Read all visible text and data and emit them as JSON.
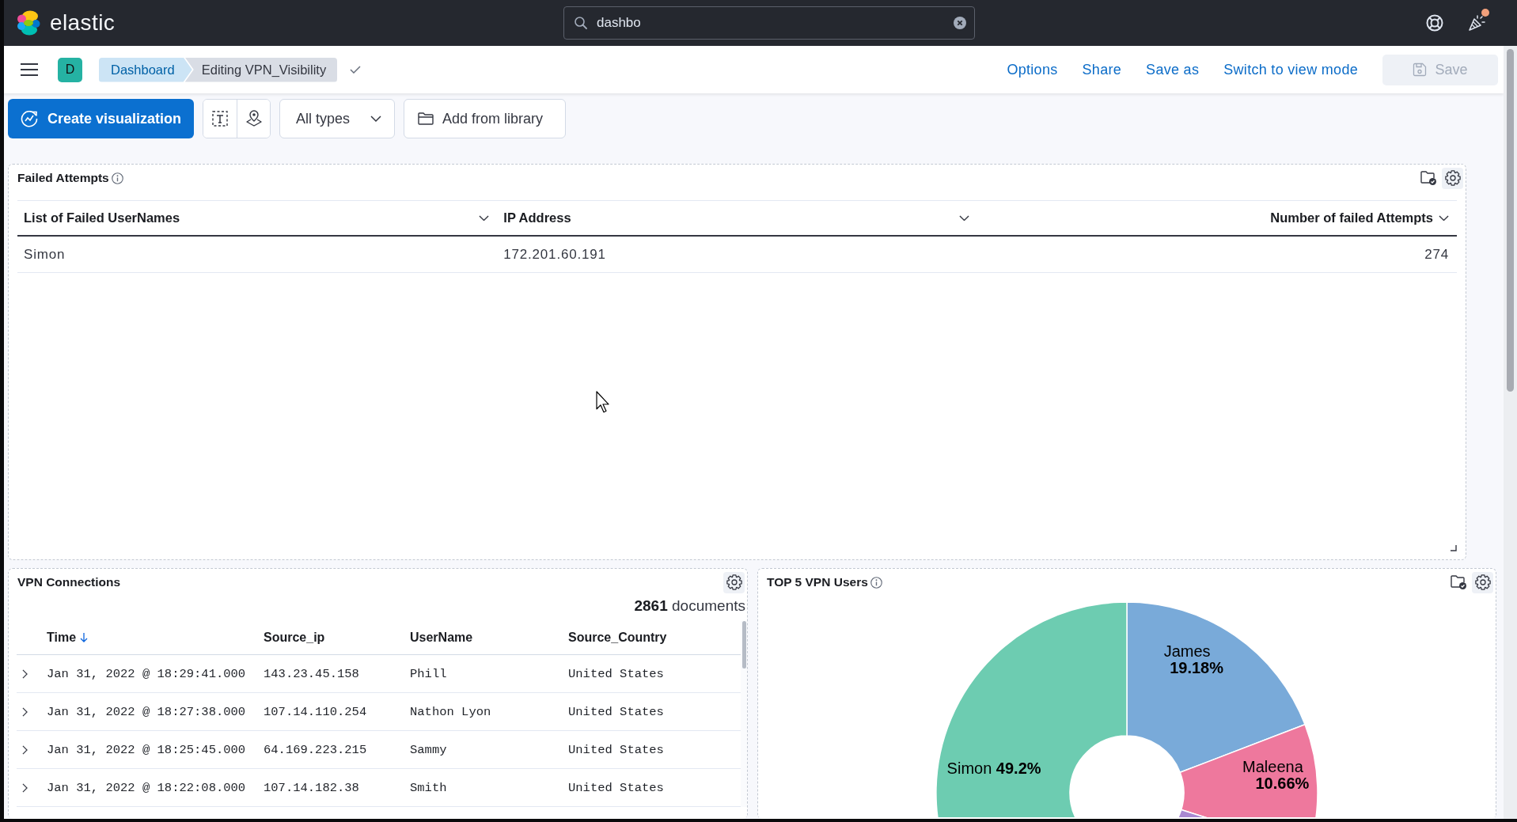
{
  "header": {
    "logo_text": "elastic",
    "search": {
      "value": "dashbo"
    },
    "news_unread": true
  },
  "app_bar": {
    "avatar": "D",
    "breadcrumbs": [
      {
        "label": "Dashboard",
        "current": false
      },
      {
        "label": "Editing VPN_Visibility",
        "current": true
      }
    ],
    "actions": [
      {
        "label": "Options"
      },
      {
        "label": "Share"
      },
      {
        "label": "Save as"
      },
      {
        "label": "Switch to view mode"
      }
    ],
    "save_button": {
      "label": "Save",
      "disabled": true
    }
  },
  "toolbar": {
    "create_button": "Create visualization",
    "type_filter": "All types",
    "library_button": "Add from library"
  },
  "panels": [
    {
      "kind": "data_table",
      "title": "Failed Attempts",
      "info": true,
      "in_library": true,
      "columns": [
        {
          "label": "List of Failed UserNames",
          "kind": "text"
        },
        {
          "label": "IP Address",
          "kind": "text"
        },
        {
          "label": "Number of failed Attempts",
          "kind": "number"
        }
      ],
      "rows": [
        [
          "Simon",
          "172.201.60.191",
          "274"
        ]
      ]
    },
    {
      "kind": "documents",
      "title": "VPN Connections",
      "info": false,
      "in_library": false,
      "hit_count": "**2861** documents",
      "columns": [
        {
          "label": "Time",
          "sorted": true
        },
        {
          "label": "Source_ip",
          "sorted": false
        },
        {
          "label": "UserName",
          "sorted": false
        },
        {
          "label": "Source_Country",
          "sorted": false
        }
      ],
      "rows": [
        [
          "Jan 31, 2022 @ 18:29:41.000",
          "143.23.45.158",
          "Phill",
          "United States"
        ],
        [
          "Jan 31, 2022 @ 18:27:38.000",
          "107.14.110.254",
          "Nathon Lyon",
          "United States"
        ],
        [
          "Jan 31, 2022 @ 18:25:45.000",
          "64.169.223.215",
          "Sammy",
          "United States"
        ],
        [
          "Jan 31, 2022 @ 18:22:08.000",
          "107.14.182.38",
          "Smith",
          "United States"
        ]
      ]
    },
    {
      "kind": "donut",
      "title": "TOP 5 VPN Users",
      "info": true,
      "in_library": true,
      "chart_data": {
        "type": "donut",
        "categories": [
          "James",
          "Maleena",
          null,
          "Simon"
        ],
        "values": [
          19.18,
          10.66,
          20.96,
          49.2
        ],
        "value_labels": [
          "19.18%",
          "10.66%",
          null,
          "49.2%"
        ],
        "colors": [
          "#79aad9",
          "#ee789d",
          "#a987d1",
          "#6dccb1"
        ]
      }
    }
  ]
}
